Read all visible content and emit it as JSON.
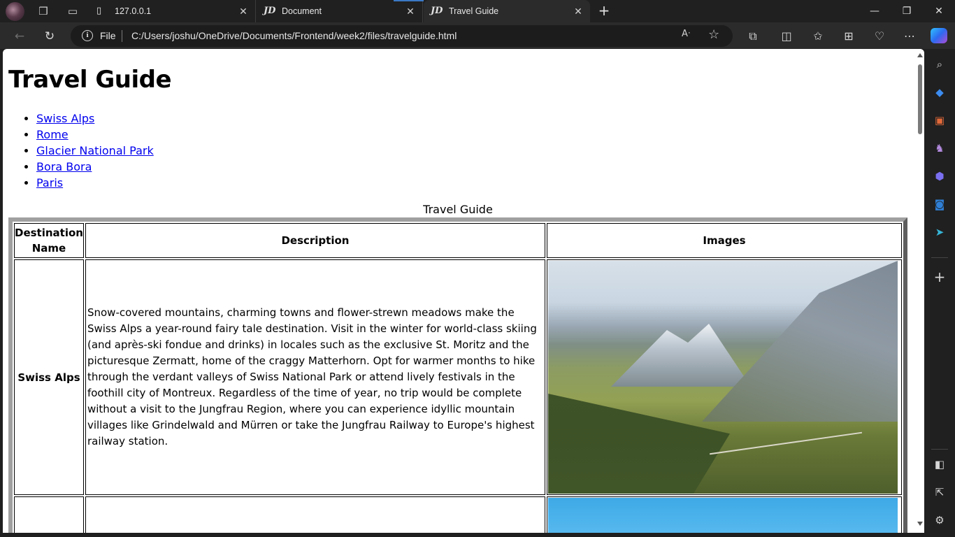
{
  "browser": {
    "tabs": [
      {
        "title": "127.0.0.1",
        "favicon": "page-icon"
      },
      {
        "title": "Document",
        "favicon": "jd-icon"
      },
      {
        "title": "Travel Guide",
        "favicon": "jd-icon",
        "active": true
      }
    ],
    "address": {
      "scheme_label": "File",
      "url": "C:/Users/joshu/OneDrive/Documents/Frontend/week2/files/travelguide.html"
    },
    "window_buttons": {
      "minimize": "—",
      "restore": "❐",
      "close": "✕"
    }
  },
  "page": {
    "heading": "Travel Guide",
    "nav_links": [
      "Swiss Alps",
      "Rome",
      "Glacier National Park",
      "Bora Bora",
      "Paris"
    ],
    "table": {
      "caption": "Travel Guide",
      "headers": [
        "Destination Name",
        "Description",
        "Images"
      ],
      "rows": [
        {
          "name": "Swiss Alps",
          "description": "Snow-covered mountains, charming towns and flower-strewn meadows make the Swiss Alps a year-round fairy tale destination. Visit in the winter for world-class skiing (and après-ski fondue and drinks) in locales such as the exclusive St. Moritz and the picturesque Zermatt, home of the craggy Matterhorn. Opt for warmer months to hike through the verdant valleys of Swiss National Park or attend lively festivals in the foothill city of Montreux. Regardless of the time of year, no trip would be complete without a visit to the Jungfrau Region, where you can experience idyllic mountain villages like Grindelwald and Mürren or take the Jungfrau Railway to Europe's highest railway station."
        }
      ]
    }
  },
  "colors": {
    "link": "#0000ee",
    "tab_accent": "#3b78c4",
    "chrome_dark": "#202020",
    "toolbar": "#2b2b2b"
  }
}
